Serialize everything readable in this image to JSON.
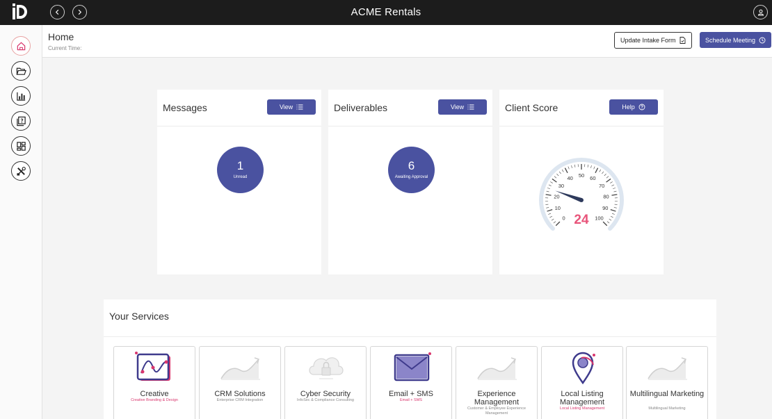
{
  "app": {
    "title": "ACME Rentals"
  },
  "header": {
    "title": "Home",
    "current_time_label": "Current Time:",
    "update_intake_label": "Update Intake Form",
    "schedule_meeting_label": "Schedule Meeting"
  },
  "sidebar": {
    "items": [
      {
        "icon": "home-icon",
        "active": true
      },
      {
        "icon": "folder-open-icon",
        "active": false
      },
      {
        "icon": "bar-chart-icon",
        "active": false
      },
      {
        "icon": "help-document-icon",
        "active": false
      },
      {
        "icon": "dashboard-grid-icon",
        "active": false
      },
      {
        "icon": "tools-icon",
        "active": false
      }
    ]
  },
  "cards": {
    "messages": {
      "title": "Messages",
      "button": "View",
      "value": "1",
      "caption": "Unread"
    },
    "deliverables": {
      "title": "Deliverables",
      "button": "View",
      "value": "6",
      "caption": "Awaiting Approval"
    },
    "client_score": {
      "title": "Client Score",
      "button": "Help",
      "score": "24",
      "gauge_labels": [
        "0",
        "10",
        "20",
        "30",
        "40",
        "50",
        "60",
        "70",
        "80",
        "90",
        "100"
      ]
    }
  },
  "services": {
    "title": "Your Services",
    "items": [
      {
        "name": "Creative",
        "sub": "Creative Branding & Design",
        "sub_color": "pink",
        "icon": "creative-icon"
      },
      {
        "name": "CRM Solutions",
        "sub": "Enterprise CRM Integration",
        "sub_color": "gray",
        "icon": "placeholder-chart-icon"
      },
      {
        "name": "Cyber Security",
        "sub": "InfoSec & Compliance Consulting",
        "sub_color": "gray",
        "icon": "cloud-lock-icon"
      },
      {
        "name": "Email + SMS",
        "sub": "Email + SMS",
        "sub_color": "pink",
        "icon": "envelope-icon"
      },
      {
        "name": "Experience Management",
        "sub": "Customer & Employee Experience Management",
        "sub_color": "gray",
        "icon": "placeholder-chart-icon"
      },
      {
        "name": "Local Listing Management",
        "sub": "Local Listing Management",
        "sub_color": "pink",
        "icon": "map-pin-icon"
      },
      {
        "name": "Multilingual Marketing",
        "sub": "Multilingual Marketing",
        "sub_color": "gray",
        "icon": "placeholder-chart-icon"
      }
    ]
  },
  "colors": {
    "primary": "#4a52a0",
    "accent_pink": "#d9376e",
    "topbar": "#1c1c1c"
  }
}
